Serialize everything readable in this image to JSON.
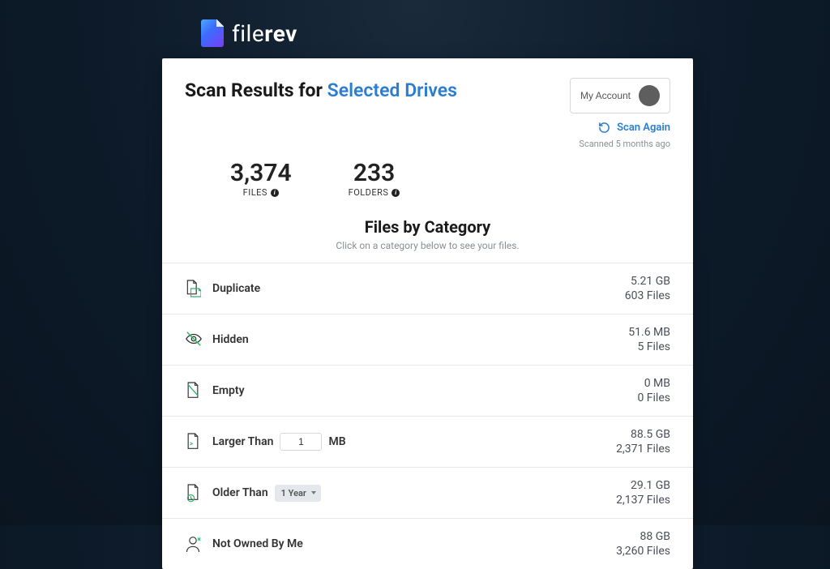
{
  "brand": {
    "name_part1": "file",
    "name_part2": "rev"
  },
  "header": {
    "title_prefix": "Scan Results for ",
    "title_link": "Selected Drives",
    "account_label": "My Account",
    "scan_again": "Scan Again",
    "scanned_ago": "Scanned 5 months ago"
  },
  "stats": {
    "files_count": "3,374",
    "files_label": "FILES",
    "folders_count": "233",
    "folders_label": "FOLDERS"
  },
  "section": {
    "title": "Files by Category",
    "subtitle": "Click on a category below to see your files."
  },
  "categories": {
    "duplicate": {
      "label": "Duplicate",
      "size": "5.21 GB",
      "files": "603 Files"
    },
    "hidden": {
      "label": "Hidden",
      "size": "51.6 MB",
      "files": "5 Files"
    },
    "empty": {
      "label": "Empty",
      "size": "0 MB",
      "files": "0 Files"
    },
    "larger": {
      "label_pre": "Larger Than",
      "input_value": "1",
      "label_post": "MB",
      "size": "88.5 GB",
      "files": "2,371 Files"
    },
    "older": {
      "label_pre": "Older Than",
      "drop_value": "1 Year",
      "size": "29.1 GB",
      "files": "2,137 Files"
    },
    "notowned": {
      "label": "Not Owned By Me",
      "size": "88 GB",
      "files": "3,260 Files"
    }
  }
}
